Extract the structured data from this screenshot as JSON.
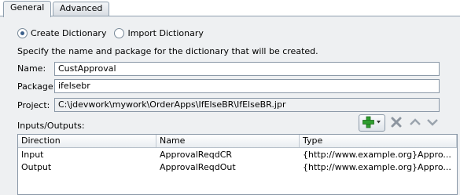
{
  "tabs": [
    {
      "label": "General",
      "active": true
    },
    {
      "label": "Advanced",
      "active": false
    }
  ],
  "mode": {
    "create_label": "Create Dictionary",
    "import_label": "Import Dictionary",
    "selected": "create"
  },
  "description": "Specify the name and package for the dictionary that will be created.",
  "fields": {
    "name_label": "Name:",
    "name_value": "CustApproval",
    "package_label": "Package:",
    "package_value": "ifelsebr",
    "project_label": "Project:",
    "project_value": "C:\\jdevwork\\mywork\\OrderApps\\IfElseBR\\IfElseBR.jpr"
  },
  "io": {
    "label": "Inputs/Outputs:",
    "toolbar": {
      "add_icon": "green-plus-icon",
      "delete_icon": "x-icon",
      "up_icon": "chevron-up-icon",
      "down_icon": "chevron-down-icon"
    },
    "columns": [
      "Direction",
      "Name",
      "Type"
    ],
    "rows": [
      [
        "Input",
        "ApprovalReqdCR",
        "{http://www.example.org}Appro..."
      ],
      [
        "Output",
        "ApprovalReqdOut",
        "{http://www.example.org}Appro..."
      ]
    ]
  },
  "colors": {
    "panel_bg": "#eef0f2",
    "add_icon_green": "#2e9d2e",
    "border": "#8a98a7"
  }
}
